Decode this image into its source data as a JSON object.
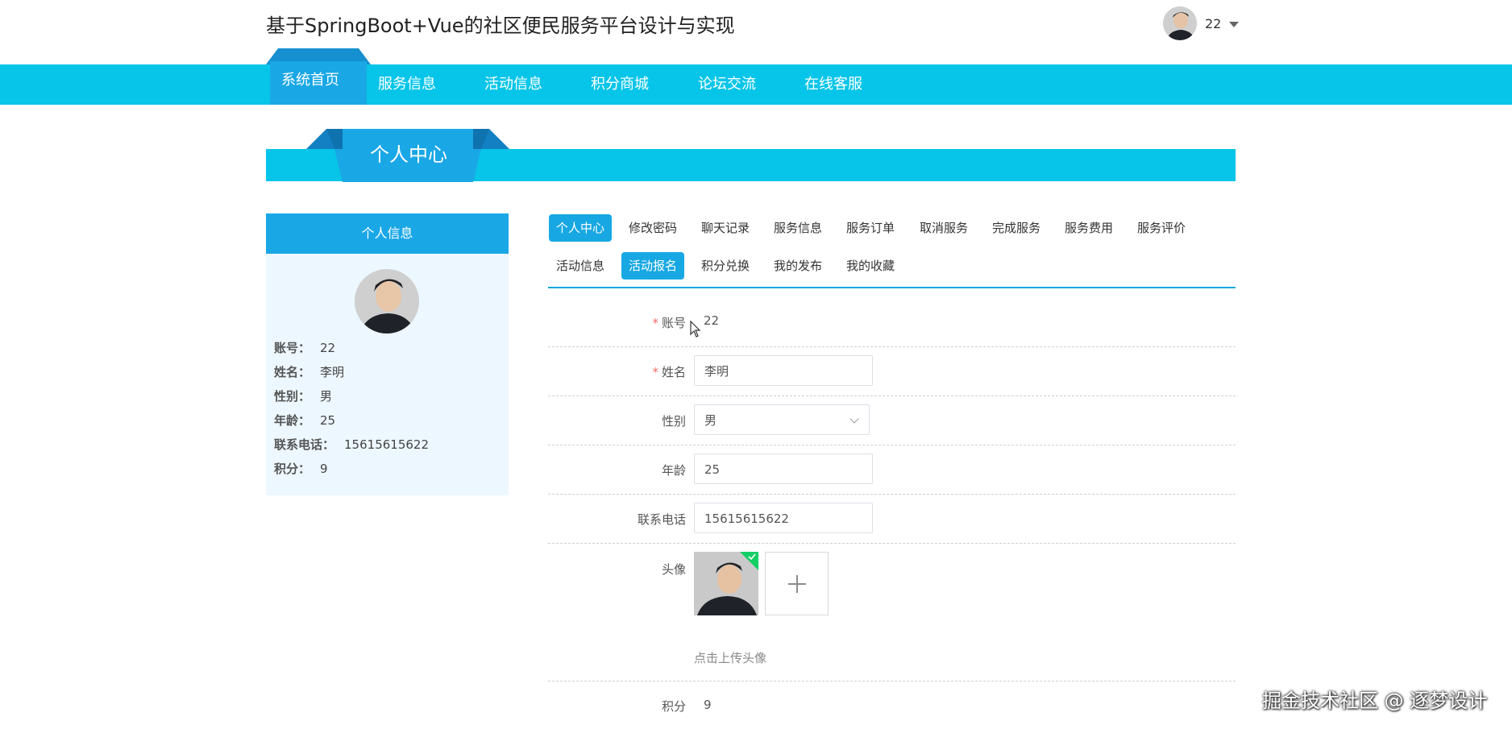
{
  "header": {
    "site_title": "基于SpringBoot+Vue的社区便民服务平台设计与实现",
    "username": "22"
  },
  "nav": {
    "items": [
      "系统首页",
      "服务信息",
      "活动信息",
      "积分商城",
      "论坛交流",
      "在线客服"
    ],
    "active_index": 0
  },
  "banner": {
    "title": "个人中心"
  },
  "sidebar": {
    "heading": "个人信息",
    "rows": [
      {
        "key": "账号：",
        "value": "22"
      },
      {
        "key": "姓名：",
        "value": "李明"
      },
      {
        "key": "性别：",
        "value": "男"
      },
      {
        "key": "年龄：",
        "value": "25"
      },
      {
        "key": "联系电话：",
        "value": "15615615622"
      },
      {
        "key": "积分：",
        "value": "9"
      }
    ]
  },
  "tabs": {
    "row1": [
      "个人中心",
      "修改密码",
      "聊天记录",
      "服务信息",
      "服务订单",
      "取消服务",
      "完成服务",
      "服务费用",
      "服务评价"
    ],
    "row2": [
      "活动信息",
      "活动报名",
      "积分兑换",
      "我的发布",
      "我的收藏"
    ],
    "active": [
      "个人中心",
      "活动报名"
    ]
  },
  "form": {
    "account": {
      "label": "账号",
      "value": "22",
      "required": true
    },
    "name": {
      "label": "姓名",
      "value": "李明",
      "required": true
    },
    "gender": {
      "label": "性别",
      "value": "男"
    },
    "age": {
      "label": "年龄",
      "value": "25"
    },
    "phone": {
      "label": "联系电话",
      "value": "15615615622"
    },
    "avatar": {
      "label": "头像",
      "hint": "点击上传头像"
    },
    "points": {
      "label": "积分",
      "value": "9"
    }
  },
  "watermark": "掘金技术社区 @ 逐梦设计",
  "colors": {
    "nav_bg": "#07c5e8",
    "accent": "#17a8e3",
    "sidebar_bg": "#edf7ff",
    "required": "#f56c6c",
    "upload_success": "#13ce66"
  },
  "icons": [
    "user-avatar",
    "caret-down-icon",
    "select-arrow-icon",
    "plus-icon",
    "check-icon",
    "mouse-cursor-icon"
  ]
}
